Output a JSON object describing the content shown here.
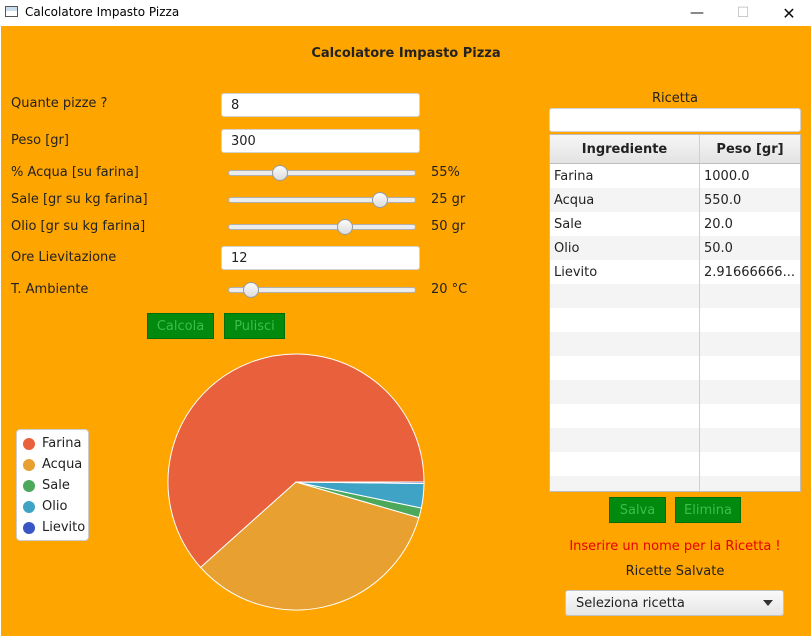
{
  "window": {
    "title": "Calcolatore Impasto Pizza"
  },
  "app": {
    "title": "Calcolatore Impasto Pizza"
  },
  "form": {
    "pizze_label": "Quante pizze ?",
    "pizze_value": "8",
    "peso_label": "Peso [gr]",
    "peso_value": "300",
    "acqua_label": "% Acqua [su farina]",
    "acqua_value": "55%",
    "acqua_level": 0.25,
    "sale_label": "Sale [gr su kg farina]",
    "sale_value": "25 gr",
    "sale_level": 0.83,
    "olio_label": "Olio [gr su kg farina]",
    "olio_value": "50 gr",
    "olio_level": 0.63,
    "ore_label": "Ore Lievitazione",
    "ore_value": "12",
    "temp_label": "T. Ambiente",
    "temp_value": "20 °C",
    "temp_level": 0.08
  },
  "buttons": {
    "calcola": "Calcola",
    "pulisci": "Pulisci",
    "salva": "Salva",
    "elimina": "Elimina"
  },
  "legend": [
    {
      "label": "Farina",
      "color": "#e8603c"
    },
    {
      "label": "Acqua",
      "color": "#e8a030"
    },
    {
      "label": "Sale",
      "color": "#4ca95c"
    },
    {
      "label": "Olio",
      "color": "#3fa3c6"
    },
    {
      "label": "Lievito",
      "color": "#3a56c4"
    }
  ],
  "chart_data": {
    "type": "pie",
    "categories": [
      "Farina",
      "Acqua",
      "Sale",
      "Olio",
      "Lievito"
    ],
    "values": [
      1000.0,
      550.0,
      20.0,
      50.0,
      2.9166666
    ],
    "colors": [
      "#e8603c",
      "#e8a030",
      "#4ca95c",
      "#3fa3c6",
      "#3a56c4"
    ],
    "legend_position": "left"
  },
  "recipe": {
    "title": "Ricetta",
    "name_value": "",
    "columns": [
      "Ingrediente",
      "Peso [gr]"
    ],
    "rows": [
      [
        "Farina",
        "1000.0"
      ],
      [
        "Acqua",
        "550.0"
      ],
      [
        "Sale",
        "20.0"
      ],
      [
        "Olio",
        "50.0"
      ],
      [
        "Lievito",
        "2.91666666..."
      ]
    ],
    "empty_rows": 9
  },
  "messages": {
    "error": "Inserire un nome per la Ricetta !"
  },
  "saved": {
    "label": "Ricette Salvate",
    "select_value": "Seleziona ricetta"
  }
}
